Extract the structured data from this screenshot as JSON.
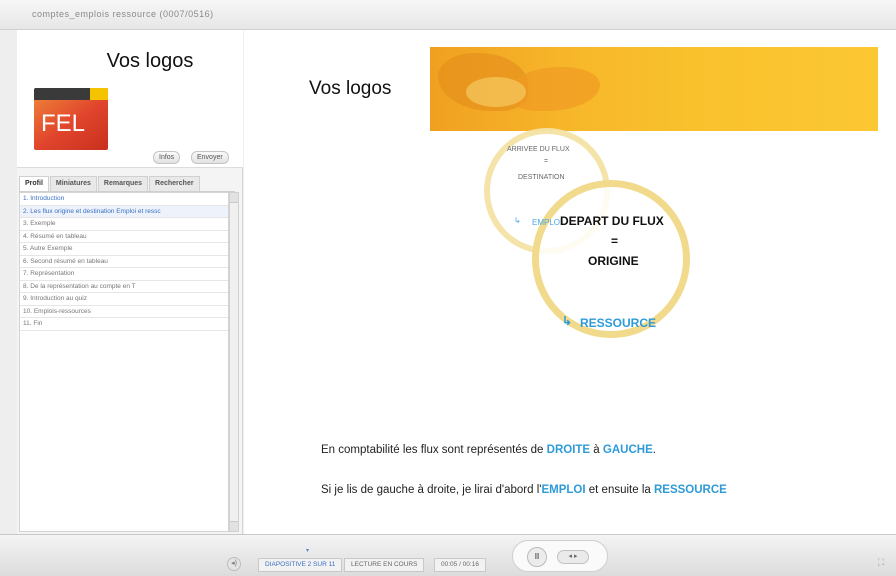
{
  "window": {
    "title": "comptes_emplois ressource   (0007/0516)"
  },
  "sidebar": {
    "logo_heading": "Vos logos",
    "logo_text": "FEL",
    "buttons": {
      "info": "Infos",
      "send": "Envoyer"
    },
    "tabs": [
      "Profil",
      "Miniatures",
      "Remarques",
      "Rechercher"
    ],
    "outline": [
      "1. Introduction",
      "2. Les flux origine et destination Emploi et ressc",
      "3. Exemple",
      "4. Résumé en tableau",
      "5. Autre Exemple",
      "6. Second résumé en tableau",
      "7. Représentation",
      "8. De la représentation au compte en T",
      "9. Introduction au quiz",
      "10. Emplois-ressources",
      "11. Fin"
    ]
  },
  "slide": {
    "heading": "Vos logos",
    "diagram": {
      "arrival": "ARRIVEE DU FLUX",
      "equals1": "=",
      "destination": "DESTINATION",
      "emploi_partial": "EMPLOI",
      "depart": "DEPART DU FLUX",
      "equals2": "=",
      "origine": "ORIGINE",
      "ressource": "RESSOURCE"
    },
    "line1": {
      "pre": "En comptabilité les flux sont représentés de ",
      "droite": "DROITE",
      "mid": " à ",
      "gauche": "GAUCHE",
      "post": "."
    },
    "line2": {
      "pre": "Si je lis de gauche à droite, je lirai d'abord l'",
      "emploi": "EMPLOI",
      "mid": " et ensuite la ",
      "ressource": "RESSOURCE"
    }
  },
  "controls": {
    "diapositive": "DIAPOSITIVE 2 SUR 11",
    "status": "LECTURE EN COURS",
    "time": "00:05 / 00:16",
    "pause_glyph": "II",
    "nav_glyph": "◂ ▸",
    "volume_glyph": "◂)",
    "fullscreen_glyph": "⛶"
  },
  "colors": {
    "accent_blue": "#2e9bd8",
    "banner_orange": "#f7b62a",
    "logo_red": "#e0442c"
  }
}
